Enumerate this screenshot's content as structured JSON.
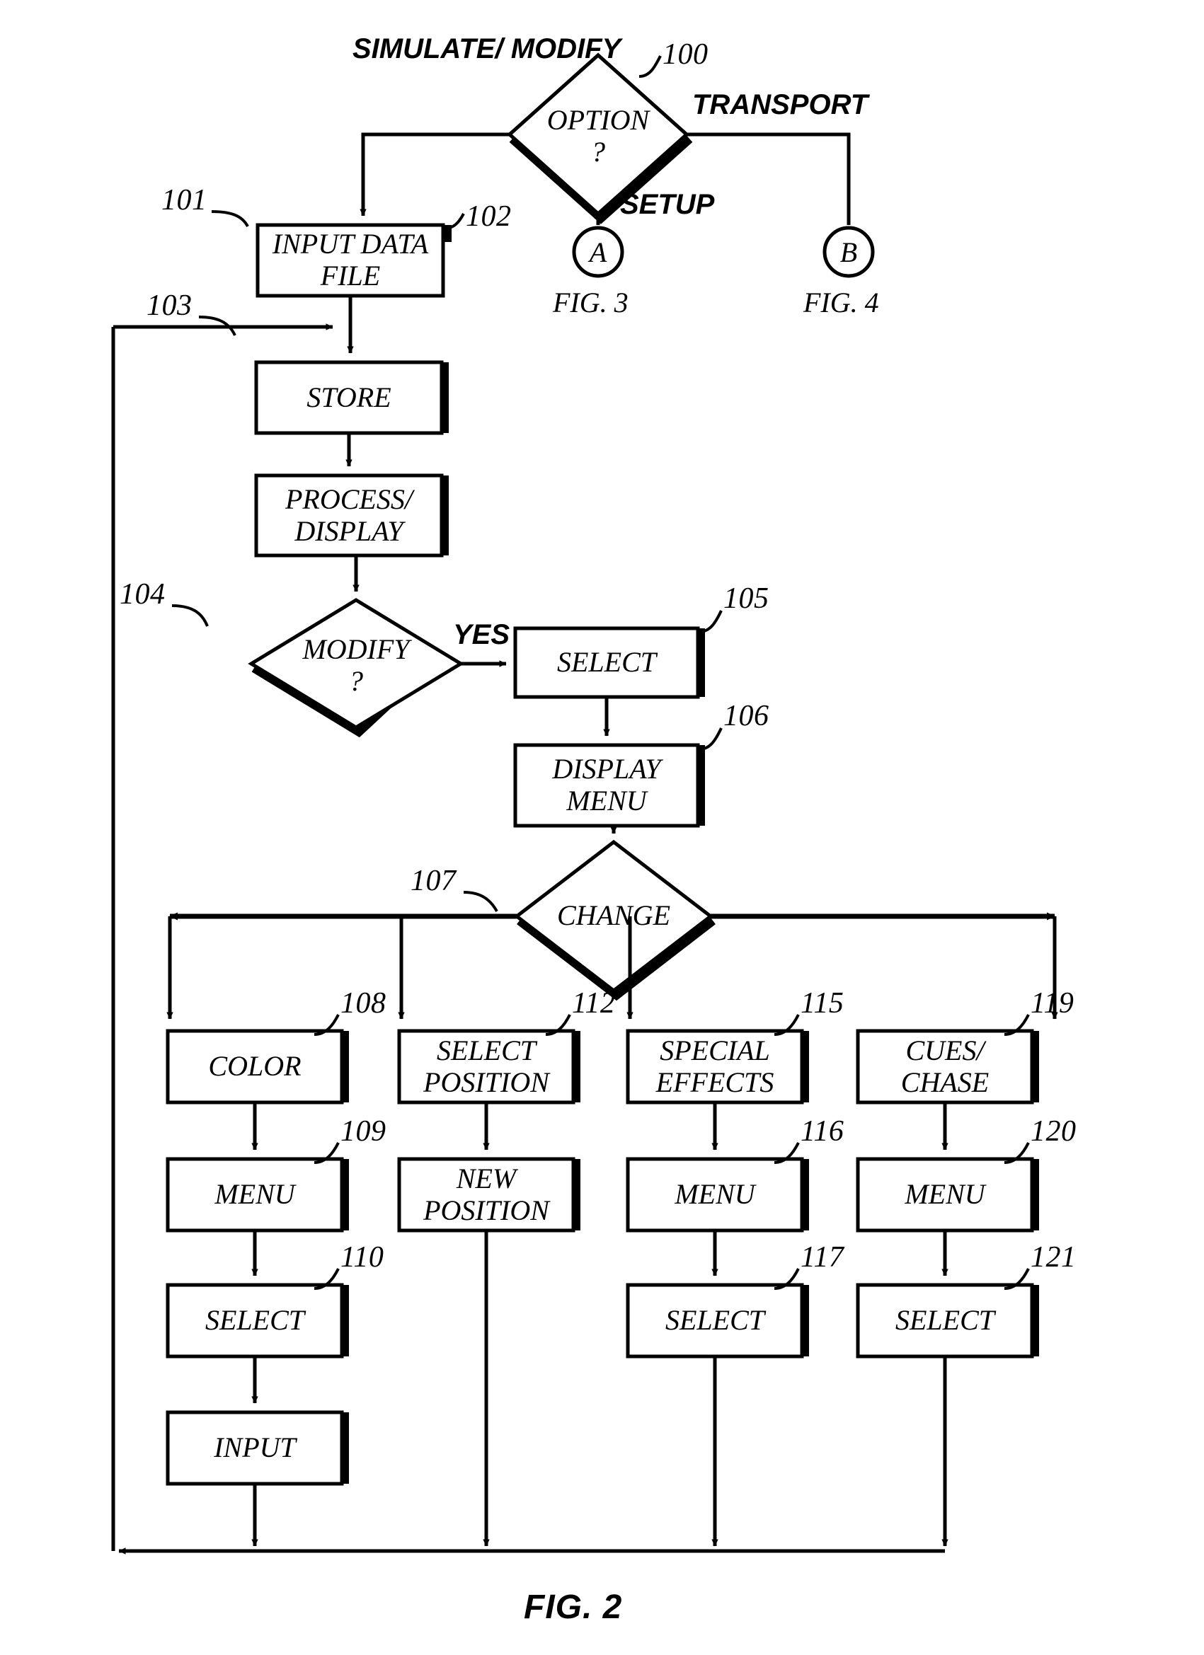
{
  "figure": {
    "caption": "FIG. 2",
    "title_ref": "FIG. 2"
  },
  "colors": {
    "line": "#000000",
    "fill": "#ffffff",
    "shadow": "#000000",
    "text": "#000000"
  },
  "decision_nodes": [
    {
      "id": "100",
      "label": "OPTION\n?",
      "ref": "100"
    },
    {
      "id": "104",
      "label": "MODIFY\n?",
      "ref": "104"
    },
    {
      "id": "107",
      "label": "CHANGE",
      "ref": "107"
    }
  ],
  "process_nodes": [
    {
      "id": "101",
      "label": "INPUT DATA\nFILE",
      "ref": "101"
    },
    {
      "id": "102",
      "label": "STORE",
      "ref": "102"
    },
    {
      "id": "103",
      "label": "PROCESS/\nDISPLAY",
      "ref": "103"
    },
    {
      "id": "105",
      "label": "SELECT",
      "ref": "105"
    },
    {
      "id": "106",
      "label": "DISPLAY\nMENU",
      "ref": "106"
    },
    {
      "id": "108",
      "label": "COLOR",
      "ref": "108"
    },
    {
      "id": "109",
      "label": "MENU",
      "ref": "109"
    },
    {
      "id": "110",
      "label": "SELECT",
      "ref": "110"
    },
    {
      "id": "111",
      "label": "INPUT",
      "ref": ""
    },
    {
      "id": "112",
      "label": "SELECT\nPOSITION",
      "ref": "112"
    },
    {
      "id": "113",
      "label": "NEW\nPOSITION",
      "ref": ""
    },
    {
      "id": "115",
      "label": "SPECIAL\nEFFECTS",
      "ref": "115"
    },
    {
      "id": "116",
      "label": "MENU",
      "ref": "116"
    },
    {
      "id": "117",
      "label": "SELECT",
      "ref": "117"
    },
    {
      "id": "119",
      "label": "CUES/\nCHASE",
      "ref": "119"
    },
    {
      "id": "120",
      "label": "MENU",
      "ref": "120"
    },
    {
      "id": "121",
      "label": "SELECT",
      "ref": "121"
    }
  ],
  "edge_labels": {
    "simulate_modify": "SIMULATE/\nMODIFY",
    "transport": "TRANSPORT",
    "setup": "SETUP",
    "yes": "YES"
  },
  "connectors": [
    {
      "letter": "A",
      "fig": "FIG. 3"
    },
    {
      "letter": "B",
      "fig": "FIG. 4"
    }
  ],
  "ref_numbers": {
    "n100": "100",
    "n101": "101",
    "n102": "102",
    "n103": "103",
    "n104": "104",
    "n105": "105",
    "n106": "106",
    "n107": "107",
    "n108": "108",
    "n109": "109",
    "n110": "110",
    "n112": "112",
    "n115": "115",
    "n116": "116",
    "n117": "117",
    "n119": "119",
    "n120": "120",
    "n121": "121"
  },
  "node_labels": {
    "option": "OPTION\n?",
    "input_data_file": "INPUT DATA\nFILE",
    "store": "STORE",
    "process_display": "PROCESS/\nDISPLAY",
    "modify": "MODIFY\n?",
    "select105": "SELECT",
    "display_menu": "DISPLAY\nMENU",
    "change": "CHANGE",
    "color": "COLOR",
    "menu109": "MENU",
    "select110": "SELECT",
    "input111": "INPUT",
    "select_position": "SELECT\nPOSITION",
    "new_position": "NEW\nPOSITION",
    "special_effects": "SPECIAL\nEFFECTS",
    "menu116": "MENU",
    "select117": "SELECT",
    "cues_chase": "CUES/\nCHASE",
    "menu120": "MENU",
    "select121": "SELECT"
  },
  "connector_letters": {
    "a": "A",
    "b": "B",
    "a_fig": "FIG. 3",
    "b_fig": "FIG. 4"
  }
}
